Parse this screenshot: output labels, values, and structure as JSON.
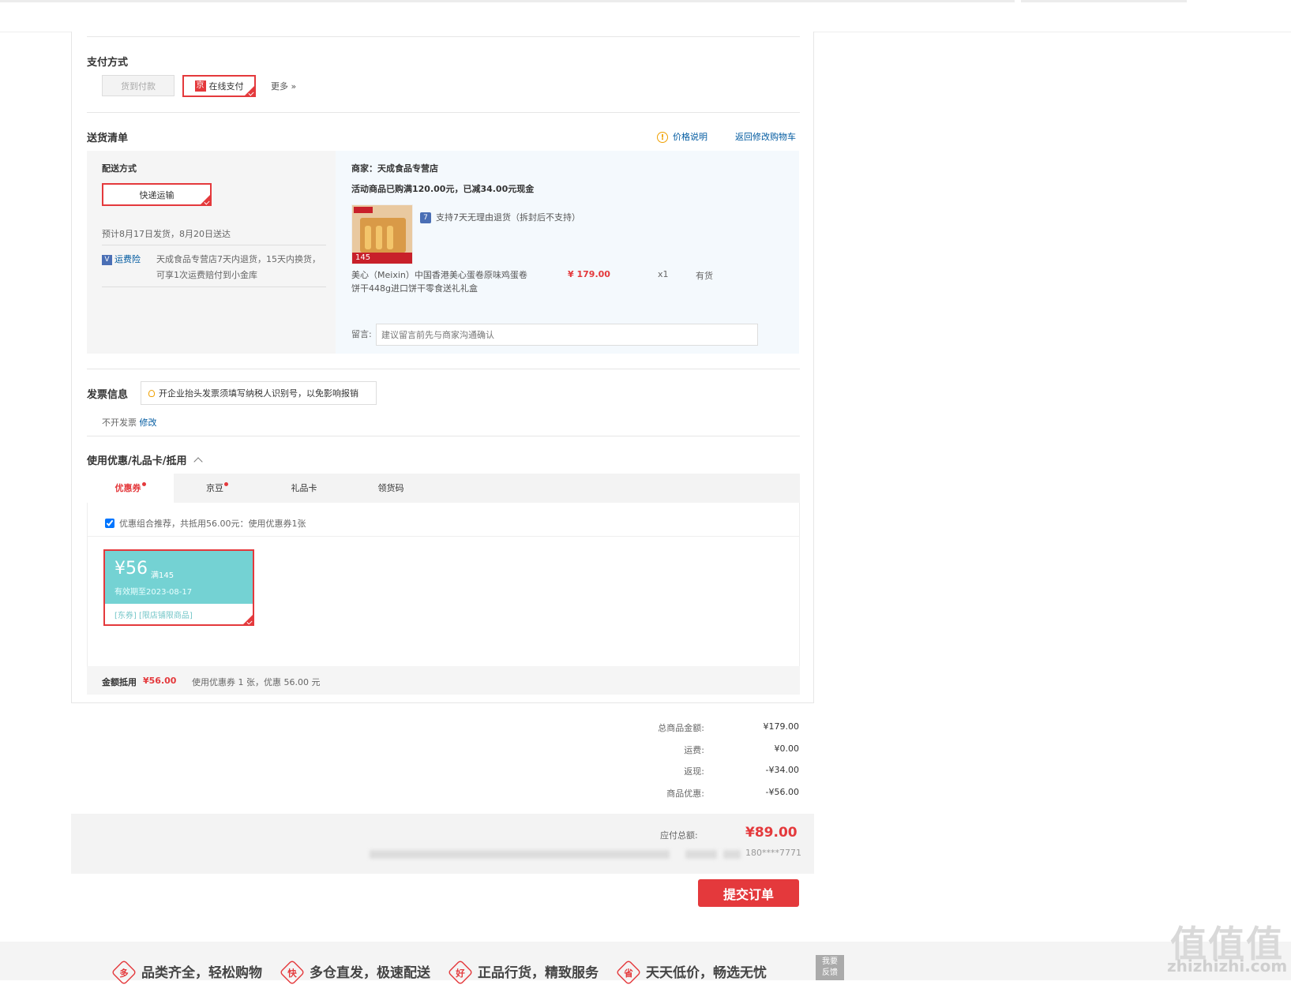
{
  "payment": {
    "title": "支付方式",
    "cod": "货到付款",
    "online_icon": "京",
    "online": "在线支付",
    "more": "更多",
    "more_arrow": "»"
  },
  "delivery": {
    "title": "送货清单",
    "price_note": "价格说明",
    "back_to_cart": "返回修改购物车",
    "method_label": "配送方式",
    "method": "快递运输",
    "estimate": "预计8月17日发货，8月20日送达",
    "insurance_icon": "V",
    "insurance_link": "运费险",
    "insurance_line1": "天成食品专营店7天内退货，15天内换货，",
    "insurance_line2": "可享1次运费赔付到小金库",
    "merchant": "商家：天成食品专营店",
    "promotion": "活动商品已购满120.00元，已减34.00元现金",
    "return_icon": "7",
    "return_policy": "支持7天无理由退货（拆封后不支持）",
    "product_tag": "145",
    "product_name_line1": "美心（Meixin）中国香港美心蛋卷原味鸡蛋卷",
    "product_name_line2": "饼干448g进口饼干零食送礼礼盒",
    "product_price": "¥ 179.00",
    "product_qty": "x1",
    "product_stock": "有货",
    "remark_label": "留言:",
    "remark_placeholder": "建议留言前先与商家沟通确认"
  },
  "invoice": {
    "title": "发票信息",
    "tip": "开企业抬头发票须填写纳税人识别号，以免影响报销",
    "status": "不开发票",
    "edit": "修改"
  },
  "discount": {
    "title": "使用优惠/礼品卡/抵用",
    "tabs": [
      "优惠券",
      "京豆",
      "礼品卡",
      "领货码"
    ],
    "recommend": "优惠组合推荐，共抵用56.00元：使用优惠券1张",
    "coupon_amount": "¥56",
    "coupon_condition": "满145",
    "coupon_expiry": "有效期至2023-08-17",
    "coupon_scope": "[东券] [限店铺限商品]",
    "total_label": "金额抵用",
    "total_value": "¥56.00",
    "total_desc": "使用优惠券 1 张，优惠 56.00 元"
  },
  "summary": {
    "rows": [
      {
        "label": "总商品金额:",
        "value": "¥179.00"
      },
      {
        "label": "运费:",
        "value": "¥0.00"
      },
      {
        "label": "返现:",
        "value": "-¥34.00"
      },
      {
        "label": "商品优惠:",
        "value": "-¥56.00"
      }
    ],
    "payable_label": "应付总额:",
    "payable_value": "¥89.00",
    "phone": "180****7771"
  },
  "submit_label": "提交订单",
  "footer": {
    "items": [
      {
        "badge": "多",
        "text": "品类齐全，轻松购物"
      },
      {
        "badge": "快",
        "text": "多仓直发，极速配送"
      },
      {
        "badge": "好",
        "text": "正品行货，精致服务"
      },
      {
        "badge": "省",
        "text": "天天低价，畅选无忧"
      }
    ],
    "feedback_line1": "我要",
    "feedback_line2": "反馈"
  },
  "watermark": {
    "logo": "值值值",
    "site": "zhizhizhi.com"
  },
  "colors": {
    "accent": "#e4393c",
    "link": "#005aa0",
    "coupon": "#74d2d3",
    "warning": "#f0a000"
  }
}
